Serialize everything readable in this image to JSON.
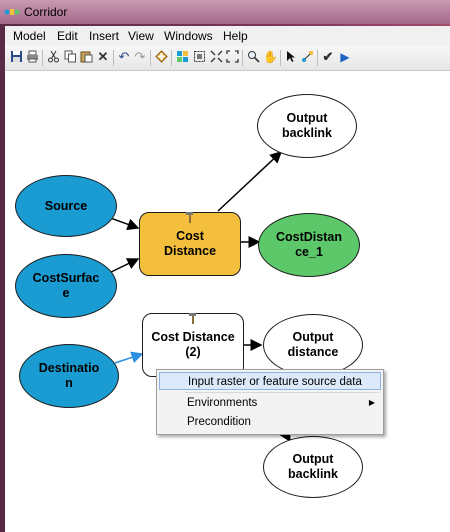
{
  "window": {
    "title": "Corridor"
  },
  "menubar": {
    "items": [
      "Model",
      "Edit",
      "Insert",
      "View",
      "Windows",
      "Help"
    ]
  },
  "toolbar": {
    "icons": [
      "save-icon",
      "print-icon",
      "cut-icon",
      "copy-icon",
      "paste-icon",
      "delete-icon",
      "undo-icon",
      "redo-icon",
      "add-data-icon",
      "auto-layout-icon",
      "select-all-icon",
      "fit-icon",
      "full-extent-icon",
      "zoom-icon",
      "pan-icon",
      "select-icon",
      "connect-icon",
      "validate-icon",
      "run-icon"
    ]
  },
  "diagram": {
    "nodes": {
      "source": "Source",
      "costsurface": "CostSurface",
      "destination": "Destination",
      "cost_distance_1": "Cost Distance",
      "cost_distance_2": "Cost Distance (2)",
      "output_backlink_1": "Output backlink",
      "costdistance_1": "CostDistance_1",
      "output_distance": "Output distance",
      "output_backlink_2": "Output backlink"
    },
    "colors": {
      "data_input": "#1a9bd1",
      "tool": "#f4bf3c",
      "derived_output": "#5cc86a",
      "output": "#ffffff"
    }
  },
  "context_menu": {
    "items": [
      {
        "label": "Input raster or feature source data",
        "highlighted": true
      },
      {
        "label": "Environments",
        "submenu": true
      },
      {
        "label": "Precondition"
      }
    ]
  }
}
